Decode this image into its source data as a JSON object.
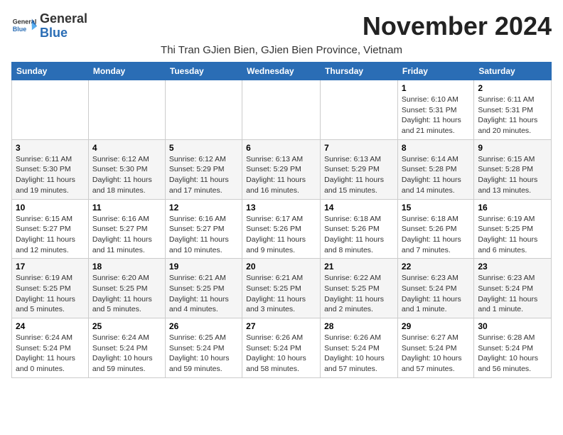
{
  "header": {
    "logo_general": "General",
    "logo_blue": "Blue",
    "month_title": "November 2024",
    "location": "Thi Tran GJien Bien, GJien Bien Province, Vietnam"
  },
  "weekdays": [
    "Sunday",
    "Monday",
    "Tuesday",
    "Wednesday",
    "Thursday",
    "Friday",
    "Saturday"
  ],
  "weeks": [
    [
      {
        "day": "",
        "detail": ""
      },
      {
        "day": "",
        "detail": ""
      },
      {
        "day": "",
        "detail": ""
      },
      {
        "day": "",
        "detail": ""
      },
      {
        "day": "",
        "detail": ""
      },
      {
        "day": "1",
        "detail": "Sunrise: 6:10 AM\nSunset: 5:31 PM\nDaylight: 11 hours and 21 minutes."
      },
      {
        "day": "2",
        "detail": "Sunrise: 6:11 AM\nSunset: 5:31 PM\nDaylight: 11 hours and 20 minutes."
      }
    ],
    [
      {
        "day": "3",
        "detail": "Sunrise: 6:11 AM\nSunset: 5:30 PM\nDaylight: 11 hours and 19 minutes."
      },
      {
        "day": "4",
        "detail": "Sunrise: 6:12 AM\nSunset: 5:30 PM\nDaylight: 11 hours and 18 minutes."
      },
      {
        "day": "5",
        "detail": "Sunrise: 6:12 AM\nSunset: 5:29 PM\nDaylight: 11 hours and 17 minutes."
      },
      {
        "day": "6",
        "detail": "Sunrise: 6:13 AM\nSunset: 5:29 PM\nDaylight: 11 hours and 16 minutes."
      },
      {
        "day": "7",
        "detail": "Sunrise: 6:13 AM\nSunset: 5:29 PM\nDaylight: 11 hours and 15 minutes."
      },
      {
        "day": "8",
        "detail": "Sunrise: 6:14 AM\nSunset: 5:28 PM\nDaylight: 11 hours and 14 minutes."
      },
      {
        "day": "9",
        "detail": "Sunrise: 6:15 AM\nSunset: 5:28 PM\nDaylight: 11 hours and 13 minutes."
      }
    ],
    [
      {
        "day": "10",
        "detail": "Sunrise: 6:15 AM\nSunset: 5:27 PM\nDaylight: 11 hours and 12 minutes."
      },
      {
        "day": "11",
        "detail": "Sunrise: 6:16 AM\nSunset: 5:27 PM\nDaylight: 11 hours and 11 minutes."
      },
      {
        "day": "12",
        "detail": "Sunrise: 6:16 AM\nSunset: 5:27 PM\nDaylight: 11 hours and 10 minutes."
      },
      {
        "day": "13",
        "detail": "Sunrise: 6:17 AM\nSunset: 5:26 PM\nDaylight: 11 hours and 9 minutes."
      },
      {
        "day": "14",
        "detail": "Sunrise: 6:18 AM\nSunset: 5:26 PM\nDaylight: 11 hours and 8 minutes."
      },
      {
        "day": "15",
        "detail": "Sunrise: 6:18 AM\nSunset: 5:26 PM\nDaylight: 11 hours and 7 minutes."
      },
      {
        "day": "16",
        "detail": "Sunrise: 6:19 AM\nSunset: 5:25 PM\nDaylight: 11 hours and 6 minutes."
      }
    ],
    [
      {
        "day": "17",
        "detail": "Sunrise: 6:19 AM\nSunset: 5:25 PM\nDaylight: 11 hours and 5 minutes."
      },
      {
        "day": "18",
        "detail": "Sunrise: 6:20 AM\nSunset: 5:25 PM\nDaylight: 11 hours and 5 minutes."
      },
      {
        "day": "19",
        "detail": "Sunrise: 6:21 AM\nSunset: 5:25 PM\nDaylight: 11 hours and 4 minutes."
      },
      {
        "day": "20",
        "detail": "Sunrise: 6:21 AM\nSunset: 5:25 PM\nDaylight: 11 hours and 3 minutes."
      },
      {
        "day": "21",
        "detail": "Sunrise: 6:22 AM\nSunset: 5:25 PM\nDaylight: 11 hours and 2 minutes."
      },
      {
        "day": "22",
        "detail": "Sunrise: 6:23 AM\nSunset: 5:24 PM\nDaylight: 11 hours and 1 minute."
      },
      {
        "day": "23",
        "detail": "Sunrise: 6:23 AM\nSunset: 5:24 PM\nDaylight: 11 hours and 1 minute."
      }
    ],
    [
      {
        "day": "24",
        "detail": "Sunrise: 6:24 AM\nSunset: 5:24 PM\nDaylight: 11 hours and 0 minutes."
      },
      {
        "day": "25",
        "detail": "Sunrise: 6:24 AM\nSunset: 5:24 PM\nDaylight: 10 hours and 59 minutes."
      },
      {
        "day": "26",
        "detail": "Sunrise: 6:25 AM\nSunset: 5:24 PM\nDaylight: 10 hours and 59 minutes."
      },
      {
        "day": "27",
        "detail": "Sunrise: 6:26 AM\nSunset: 5:24 PM\nDaylight: 10 hours and 58 minutes."
      },
      {
        "day": "28",
        "detail": "Sunrise: 6:26 AM\nSunset: 5:24 PM\nDaylight: 10 hours and 57 minutes."
      },
      {
        "day": "29",
        "detail": "Sunrise: 6:27 AM\nSunset: 5:24 PM\nDaylight: 10 hours and 57 minutes."
      },
      {
        "day": "30",
        "detail": "Sunrise: 6:28 AM\nSunset: 5:24 PM\nDaylight: 10 hours and 56 minutes."
      }
    ]
  ]
}
